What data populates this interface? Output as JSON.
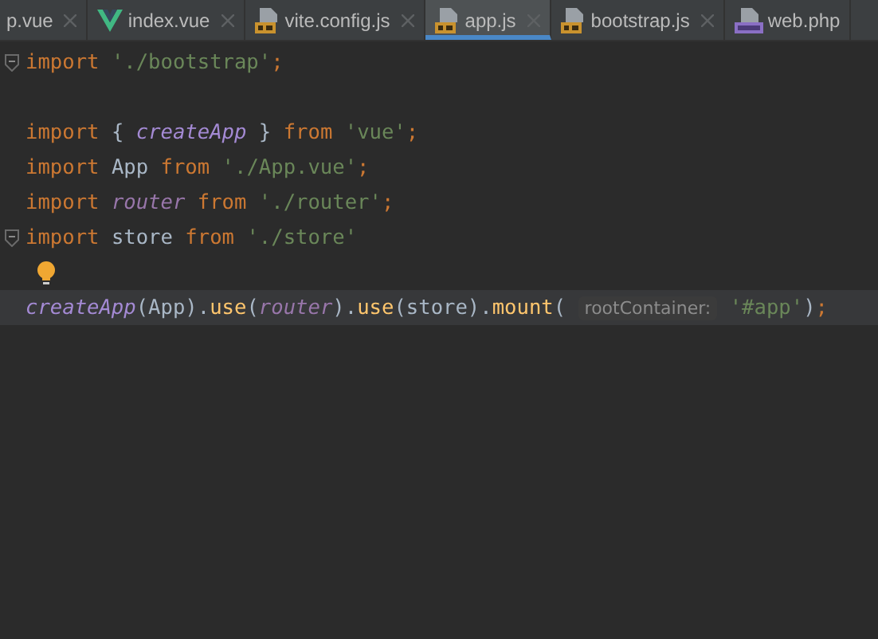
{
  "tabs": [
    {
      "label": "p.vue",
      "kind": "plain",
      "selected": false
    },
    {
      "label": "index.vue",
      "kind": "vue",
      "selected": false
    },
    {
      "label": "vite.config.js",
      "kind": "js",
      "selected": false
    },
    {
      "label": "app.js",
      "kind": "js",
      "selected": true
    },
    {
      "label": "bootstrap.js",
      "kind": "js",
      "selected": false
    },
    {
      "label": "web.php",
      "kind": "php",
      "selected": false
    }
  ],
  "editor": {
    "lines": [
      {
        "fold": true,
        "current": false,
        "tokens": [
          {
            "kind": "keyword",
            "text": "import "
          },
          {
            "kind": "string",
            "text": "'./bootstrap'"
          },
          {
            "kind": "punct",
            "text": ";"
          }
        ]
      },
      {
        "fold": false,
        "current": false
      },
      {
        "fold": false,
        "current": false,
        "tokens": [
          {
            "kind": "keyword",
            "text": "import "
          },
          {
            "kind": "plain",
            "text": "{ "
          },
          {
            "kind": "func",
            "text": "createApp"
          },
          {
            "kind": "plain",
            "text": " } "
          },
          {
            "kind": "keyword",
            "text": "from "
          },
          {
            "kind": "string",
            "text": "'vue'"
          },
          {
            "kind": "punct",
            "text": ";"
          }
        ]
      },
      {
        "fold": false,
        "current": false,
        "tokens": [
          {
            "kind": "keyword",
            "text": "import "
          },
          {
            "kind": "plain",
            "text": "App "
          },
          {
            "kind": "keyword",
            "text": "from "
          },
          {
            "kind": "string",
            "text": "'./App.vue'"
          },
          {
            "kind": "punct",
            "text": ";"
          }
        ]
      },
      {
        "fold": false,
        "current": false,
        "tokens": [
          {
            "kind": "keyword",
            "text": "import "
          },
          {
            "kind": "var",
            "text": "router"
          },
          {
            "kind": "keyword",
            "text": " from "
          },
          {
            "kind": "string",
            "text": "'./router'"
          },
          {
            "kind": "punct",
            "text": ";"
          }
        ]
      },
      {
        "fold": true,
        "current": false,
        "tokens": [
          {
            "kind": "keyword",
            "text": "import "
          },
          {
            "kind": "plain",
            "text": "store "
          },
          {
            "kind": "keyword",
            "text": "from "
          },
          {
            "kind": "string",
            "text": "'./store'"
          }
        ]
      },
      {
        "fold": false,
        "current": false,
        "bulb": true
      },
      {
        "fold": false,
        "current": true,
        "tokens": [
          {
            "kind": "func",
            "text": "createApp"
          },
          {
            "kind": "plain",
            "text": "(App)."
          },
          {
            "kind": "method",
            "text": "use"
          },
          {
            "kind": "plain",
            "text": "("
          },
          {
            "kind": "var",
            "text": "router"
          },
          {
            "kind": "plain",
            "text": ")."
          },
          {
            "kind": "method",
            "text": "use"
          },
          {
            "kind": "plain",
            "text": "(store)."
          },
          {
            "kind": "method",
            "text": "mount"
          },
          {
            "kind": "plain",
            "text": "( "
          },
          {
            "kind": "hint",
            "text": "rootContainer:"
          },
          {
            "kind": "string",
            "text": " '#app'"
          },
          {
            "kind": "plain",
            "text": ")"
          },
          {
            "kind": "punct",
            "text": ";"
          }
        ]
      }
    ]
  }
}
